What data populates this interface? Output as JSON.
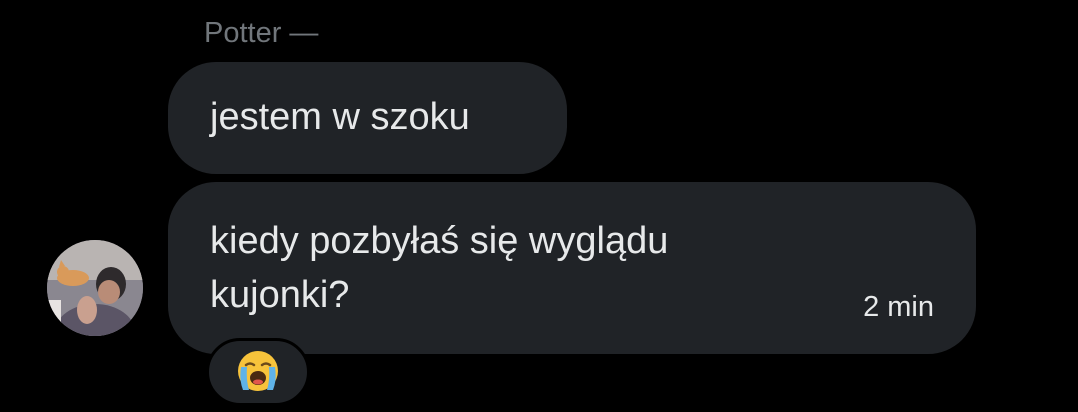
{
  "conversation": {
    "sender_name": "Potter —",
    "messages": [
      {
        "text": "jestem w szoku"
      },
      {
        "text": "kiedy pozbyłaś się wyglądu kujonki?",
        "timestamp": "2 min"
      }
    ],
    "reaction": {
      "icon": "loudly-crying-face-emoji"
    },
    "avatar": {
      "icon": "user-avatar-photo"
    }
  },
  "colors": {
    "background": "#000000",
    "bubble": "#202327",
    "primary_text": "#e7e9ea",
    "secondary_text": "#71767b"
  }
}
